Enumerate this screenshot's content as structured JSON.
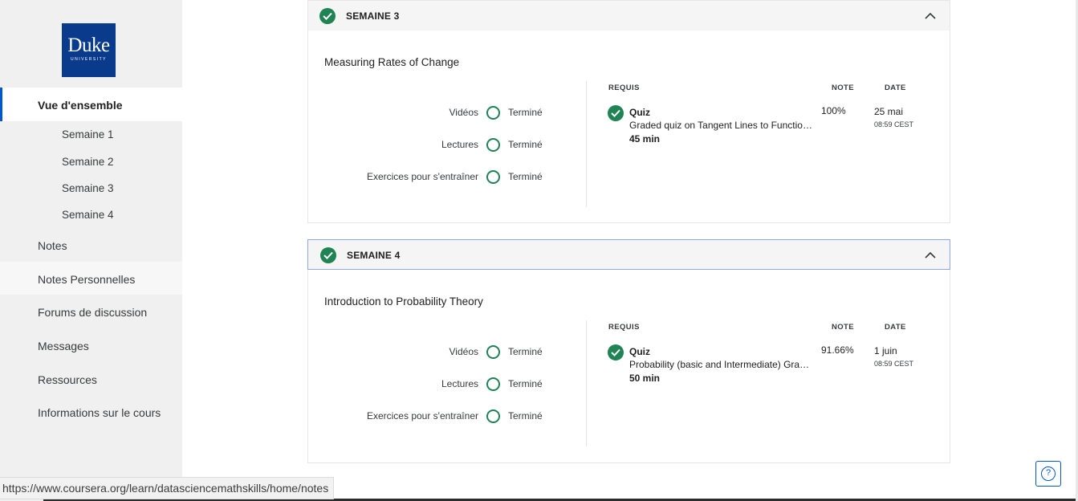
{
  "sidebar": {
    "logo": {
      "main": "Duke",
      "sub": "UNIVERSITY"
    },
    "active_item": "Vue d'ensemble",
    "sub_items": [
      "Semaine 1",
      "Semaine 2",
      "Semaine 3",
      "Semaine 4"
    ],
    "items": [
      "Notes",
      "Notes Personnelles",
      "Forums de discussion",
      "Messages",
      "Ressources",
      "Informations sur le cours"
    ]
  },
  "columns": {
    "required": "REQUIS",
    "grade": "NOTE",
    "date": "DATE"
  },
  "progress_labels": [
    "Vidéos",
    "Lectures",
    "Exercices pour s'entraîner"
  ],
  "weeks": [
    {
      "title": "SEMAINE 3",
      "module": "Measuring Rates of Change",
      "statuses": [
        "Terminé",
        "Terminé",
        "Terminé"
      ],
      "quiz": {
        "type": "Quiz",
        "name": "Graded quiz on Tangent Lines to Functions, Exponents and Logarithms",
        "duration": "45  min",
        "grade": "100%",
        "date": "25 mai",
        "time": "08:59 CEST"
      }
    },
    {
      "title": "SEMAINE 4",
      "module": "Introduction to Probability Theory",
      "statuses": [
        "Terminé",
        "Terminé",
        "Terminé"
      ],
      "quiz": {
        "type": "Quiz",
        "name": "Probability (basic and Intermediate) Graded Quiz",
        "duration": "50  min",
        "grade": "91.66%",
        "date": "1 juin",
        "time": "08:59 CEST"
      }
    }
  ],
  "status_bar": {
    "url": "https://www.coursera.org/learn/datasciencemathskills/home/notes"
  },
  "help": {
    "icon": "question-mark-icon",
    "glyph": "?"
  },
  "colors": {
    "accent": "#0056d2",
    "success": "#1f8354",
    "logo_bg": "#0a3a8c"
  }
}
